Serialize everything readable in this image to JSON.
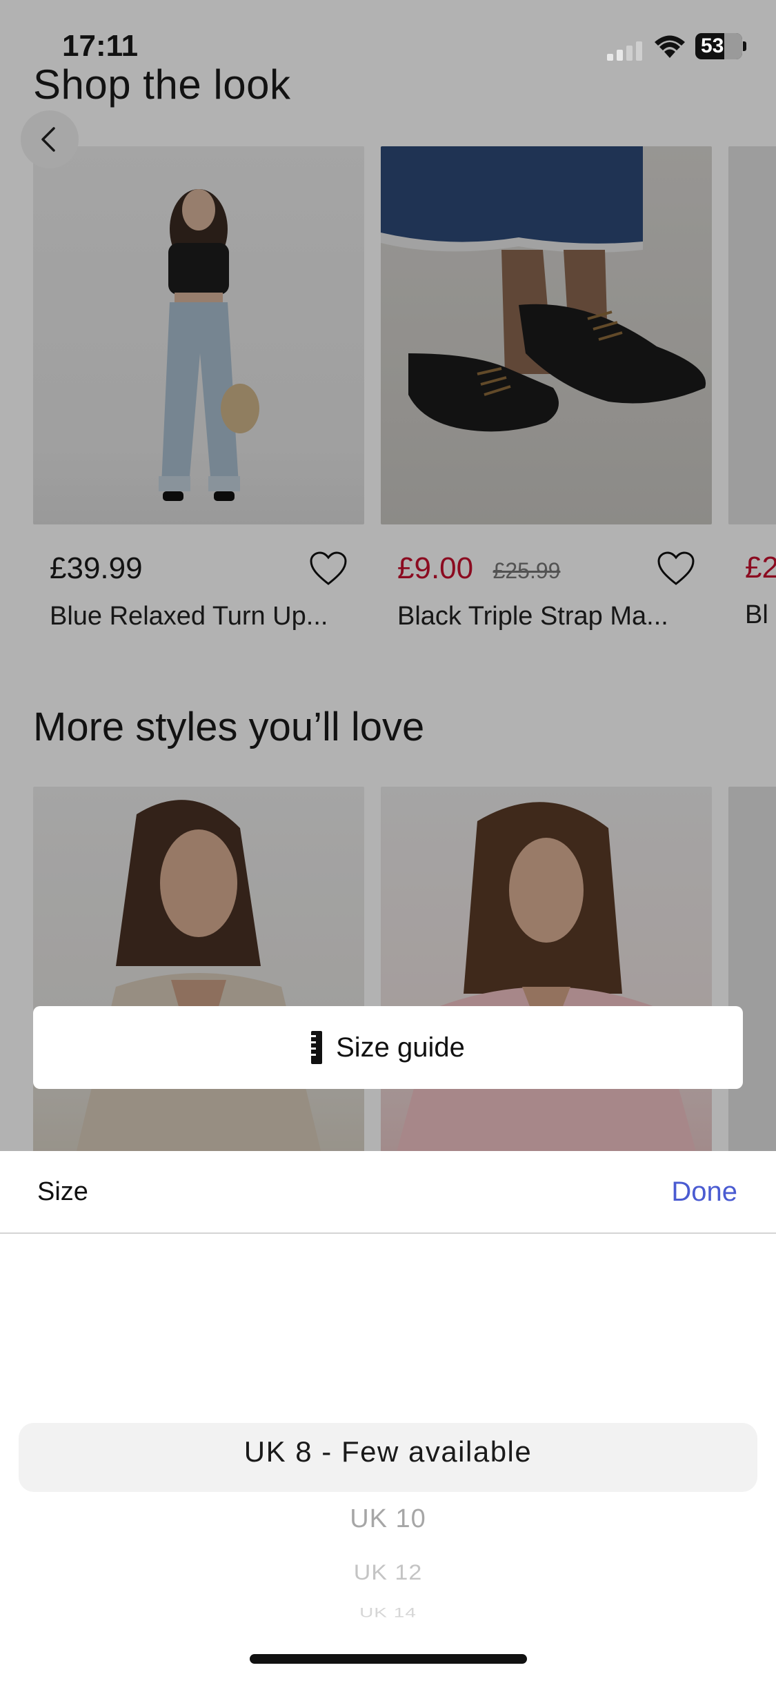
{
  "status_bar": {
    "time": "17:11",
    "battery": "53"
  },
  "shop_the_look": {
    "title": "Shop the look",
    "products": [
      {
        "price": "£39.99",
        "name": "Blue Relaxed Turn Up...",
        "image": "jeans-outfit"
      },
      {
        "price": "£9.00",
        "was_price": "£25.99",
        "name": "Black Triple Strap Ma...",
        "image": "black-shoes"
      },
      {
        "price": "£2",
        "name": "Bl",
        "image": "peek"
      }
    ]
  },
  "more_styles": {
    "title": "More styles you’ll love",
    "products": [
      {
        "image": "cream-vest"
      },
      {
        "image": "pink-blouse"
      }
    ]
  },
  "size_guide": {
    "label": "Size guide",
    "icon": "ruler-icon"
  },
  "size_sheet": {
    "title": "Size",
    "done_label": "Done",
    "options": [
      "UK 8 - Few available",
      "UK 10",
      "UK 12",
      "UK 14"
    ],
    "selected": "UK 8 - Few available"
  },
  "colors": {
    "sale": "#c8102e",
    "accent": "#4a5bd1"
  }
}
